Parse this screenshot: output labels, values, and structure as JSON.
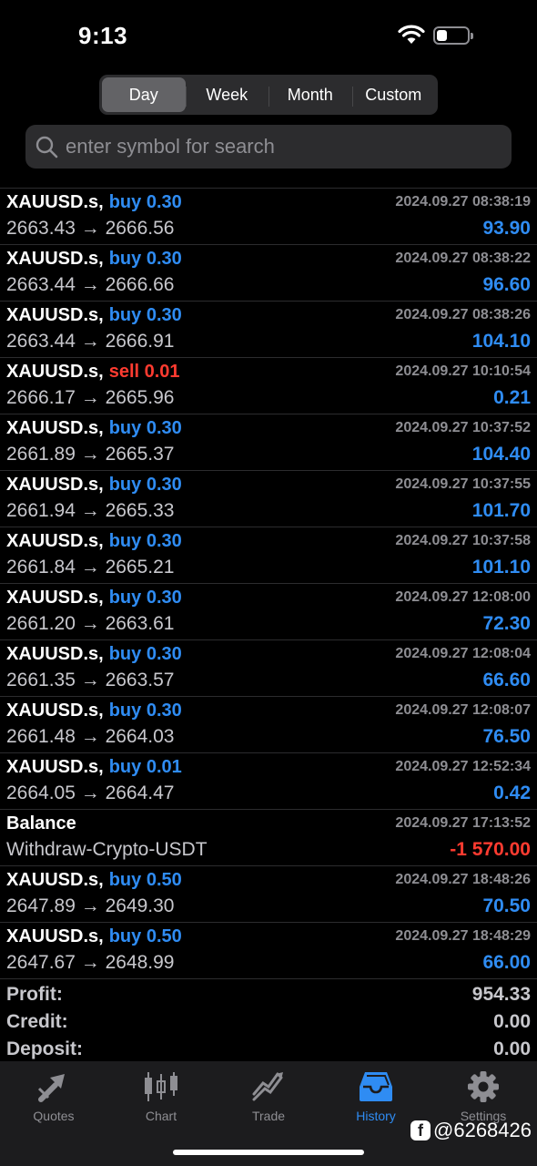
{
  "status_bar": {
    "time": "9:13",
    "battery_level": 0.35
  },
  "period_tabs": [
    {
      "label": "Day",
      "active": true
    },
    {
      "label": "Week",
      "active": false
    },
    {
      "label": "Month",
      "active": false
    },
    {
      "label": "Custom",
      "active": false
    }
  ],
  "search": {
    "placeholder": "enter symbol for search",
    "value": ""
  },
  "deals": [
    {
      "symbol": "XAUUSD.s,",
      "side": "buy 0.30",
      "side_color": "#2f8cf3",
      "time": "2024.09.27 08:38:19",
      "prices": "2663.43 → 2666.56",
      "profit": "93.90",
      "profit_color": "#2f8cf3"
    },
    {
      "symbol": "XAUUSD.s,",
      "side": "buy 0.30",
      "side_color": "#2f8cf3",
      "time": "2024.09.27 08:38:22",
      "prices": "2663.44 → 2666.66",
      "profit": "96.60",
      "profit_color": "#2f8cf3"
    },
    {
      "symbol": "XAUUSD.s,",
      "side": "buy 0.30",
      "side_color": "#2f8cf3",
      "time": "2024.09.27 08:38:26",
      "prices": "2663.44 → 2666.91",
      "profit": "104.10",
      "profit_color": "#2f8cf3"
    },
    {
      "symbol": "XAUUSD.s,",
      "side": "sell 0.01",
      "side_color": "#ff3b30",
      "time": "2024.09.27 10:10:54",
      "prices": "2666.17 → 2665.96",
      "profit": "0.21",
      "profit_color": "#2f8cf3"
    },
    {
      "symbol": "XAUUSD.s,",
      "side": "buy 0.30",
      "side_color": "#2f8cf3",
      "time": "2024.09.27 10:37:52",
      "prices": "2661.89 → 2665.37",
      "profit": "104.40",
      "profit_color": "#2f8cf3"
    },
    {
      "symbol": "XAUUSD.s,",
      "side": "buy 0.30",
      "side_color": "#2f8cf3",
      "time": "2024.09.27 10:37:55",
      "prices": "2661.94 → 2665.33",
      "profit": "101.70",
      "profit_color": "#2f8cf3"
    },
    {
      "symbol": "XAUUSD.s,",
      "side": "buy 0.30",
      "side_color": "#2f8cf3",
      "time": "2024.09.27 10:37:58",
      "prices": "2661.84 → 2665.21",
      "profit": "101.10",
      "profit_color": "#2f8cf3"
    },
    {
      "symbol": "XAUUSD.s,",
      "side": "buy 0.30",
      "side_color": "#2f8cf3",
      "time": "2024.09.27 12:08:00",
      "prices": "2661.20 → 2663.61",
      "profit": "72.30",
      "profit_color": "#2f8cf3"
    },
    {
      "symbol": "XAUUSD.s,",
      "side": "buy 0.30",
      "side_color": "#2f8cf3",
      "time": "2024.09.27 12:08:04",
      "prices": "2661.35 → 2663.57",
      "profit": "66.60",
      "profit_color": "#2f8cf3"
    },
    {
      "symbol": "XAUUSD.s,",
      "side": "buy 0.30",
      "side_color": "#2f8cf3",
      "time": "2024.09.27 12:08:07",
      "prices": "2661.48 → 2664.03",
      "profit": "76.50",
      "profit_color": "#2f8cf3"
    },
    {
      "symbol": "XAUUSD.s,",
      "side": "buy 0.01",
      "side_color": "#2f8cf3",
      "time": "2024.09.27 12:52:34",
      "prices": "2664.05 → 2664.47",
      "profit": "0.42",
      "profit_color": "#2f8cf3"
    },
    {
      "symbol": "Balance",
      "side": "",
      "side_color": "#2f8cf3",
      "time": "2024.09.27 17:13:52",
      "prices": "Withdraw-Crypto-USDT",
      "profit": "-1 570.00",
      "profit_color": "#ff3b30"
    },
    {
      "symbol": "XAUUSD.s,",
      "side": "buy 0.50",
      "side_color": "#2f8cf3",
      "time": "2024.09.27 18:48:26",
      "prices": "2647.89 → 2649.30",
      "profit": "70.50",
      "profit_color": "#2f8cf3"
    },
    {
      "symbol": "XAUUSD.s,",
      "side": "buy 0.50",
      "side_color": "#2f8cf3",
      "time": "2024.09.27 18:48:29",
      "prices": "2647.67 → 2648.99",
      "profit": "66.00",
      "profit_color": "#2f8cf3"
    }
  ],
  "summary": {
    "profit_label": "Profit:",
    "profit_value": "954.33",
    "credit_label": "Credit:",
    "credit_value": "0.00",
    "deposit_label": "Deposit:",
    "deposit_value": "0.00"
  },
  "tabbar": [
    {
      "label": "Quotes",
      "icon": "quotes-icon",
      "active": false
    },
    {
      "label": "Chart",
      "icon": "chart-candles-icon",
      "active": false
    },
    {
      "label": "Trade",
      "icon": "trade-icon",
      "active": false
    },
    {
      "label": "History",
      "icon": "history-icon",
      "active": true
    },
    {
      "label": "Settings",
      "icon": "gear-icon",
      "active": false
    }
  ],
  "watermark": "@6268426",
  "colors": {
    "accent": "#2f8cf3",
    "negative": "#ff3b30",
    "muted": "#8e8e93",
    "background": "#000000"
  }
}
